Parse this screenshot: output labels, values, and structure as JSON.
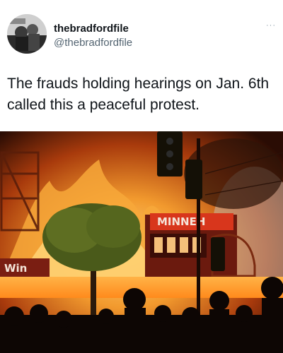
{
  "user": {
    "display_name": "thebradfordfile",
    "handle": "@thebradfordfile"
  },
  "more_label": "···",
  "tweet": {
    "text": "The frauds holding hearings on Jan. 6th called this a peaceful protest."
  },
  "media": {
    "sign_text": "MINNEH",
    "side_text": "Win",
    "icon": "burning-building-photo"
  }
}
